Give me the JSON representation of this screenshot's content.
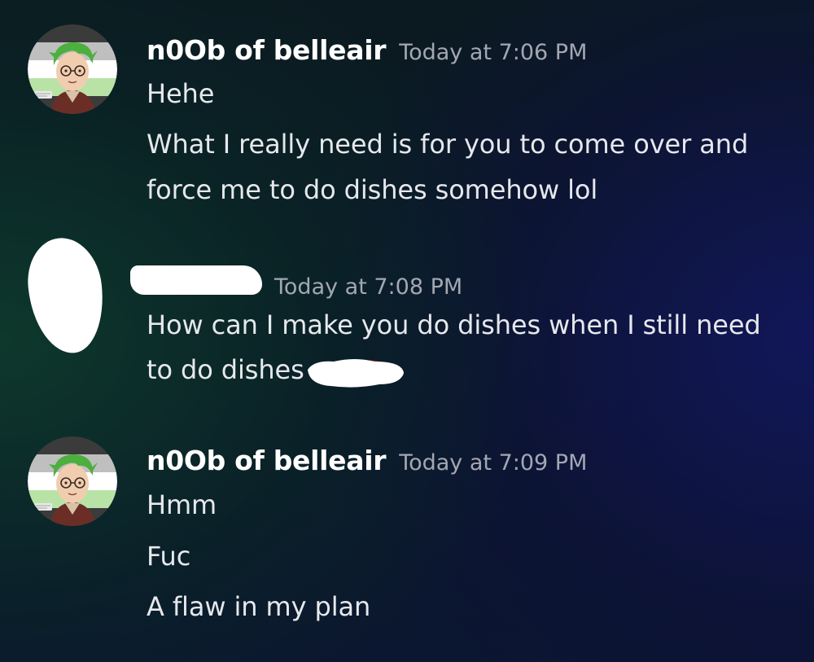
{
  "messages": [
    {
      "author": "n0Ob of belleair",
      "timestamp": "Today at 7:06 PM",
      "lines": [
        "Hehe",
        "What I really need is for you to come over and",
        "force me to do dishes somehow lol"
      ]
    },
    {
      "author": "",
      "timestamp": "Today at 7:08 PM",
      "lines": [
        "How can I make you do dishes when I still need",
        "to do dishes"
      ]
    },
    {
      "author": "n0Ob of belleair",
      "timestamp": "Today at 7:09 PM",
      "lines": [
        "Hmm",
        "Fuc",
        "A flaw in my plan"
      ]
    }
  ],
  "colors": {
    "username": "#ffffff",
    "timestamp": "#a3a7b1",
    "message_text": "#e6e8ec",
    "avatar_hair": "#4caf3e",
    "redaction": "#ffffff"
  },
  "icons": {
    "avatar": "cartoon-avatar-green-hair-glasses",
    "redacted_avatar": "white-scribble-redaction"
  }
}
